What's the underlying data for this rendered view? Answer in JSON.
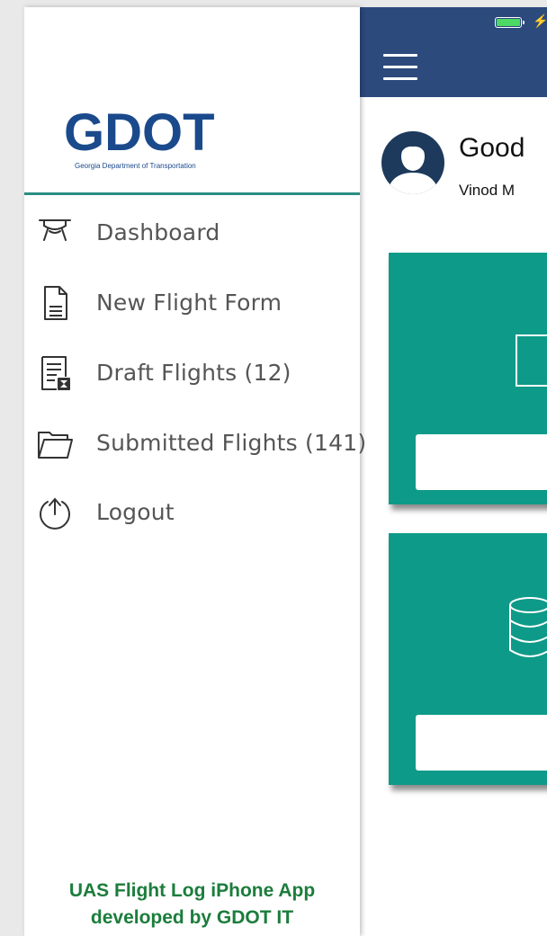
{
  "main": {
    "greeting": "Good",
    "user_name": "Vinod M"
  },
  "drawer": {
    "logo": {
      "text": "GDOT",
      "subtitle": "Georgia Department of Transportation"
    },
    "menu": [
      {
        "label": "Dashboard",
        "icon": "drone-icon"
      },
      {
        "label": "New Flight Form",
        "icon": "document-icon"
      },
      {
        "label": "Draft Flights (12)",
        "icon": "draft-document-hourglass-icon"
      },
      {
        "label": "Submitted Flights (141)",
        "icon": "folder-icon"
      },
      {
        "label": "Logout",
        "icon": "logout-arrow-up-icon"
      }
    ],
    "footer": {
      "line1": "UAS Flight Log iPhone App",
      "line2": "developed by GDOT IT"
    }
  },
  "colors": {
    "navbar": "#2c4a7c",
    "card": "#0e9a88",
    "divider": "#2a8e82",
    "logo": "#1a4a8c",
    "footer_text": "#1b7d3c"
  }
}
